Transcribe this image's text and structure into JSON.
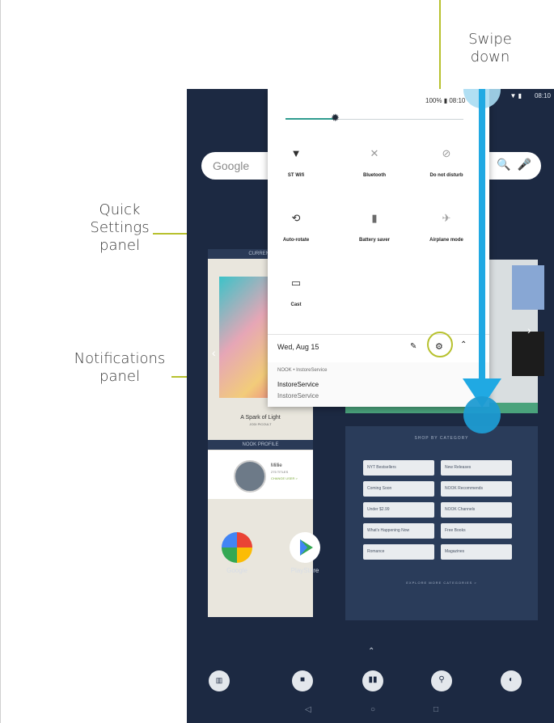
{
  "annotations": {
    "swipe": "Swipe\ndown",
    "quick_settings": "Quick\nSettings\npanel",
    "notifications": "Notifications\npanel"
  },
  "status_bar": {
    "battery": "100%",
    "time": "08:10",
    "right_time": "08:10"
  },
  "quick_settings": {
    "tiles": [
      {
        "icon": "wifi-icon",
        "label": "ST Wifi"
      },
      {
        "icon": "bluetooth-icon",
        "label": "Bluetooth"
      },
      {
        "icon": "do-not-disturb-icon",
        "label": "Do not disturb"
      },
      {
        "icon": "auto-rotate-icon",
        "label": "Auto-rotate"
      },
      {
        "icon": "battery-saver-icon",
        "label": "Battery saver"
      },
      {
        "icon": "airplane-mode-icon",
        "label": "Airplane mode"
      },
      {
        "icon": "cast-icon",
        "label": "Cast"
      }
    ]
  },
  "notifications": {
    "date": "Wed, Aug 15",
    "app_line": "NOOK • InstoreService",
    "title": "InstoreService",
    "text": "InstoreService"
  },
  "home": {
    "search_logo": "Google",
    "current_header": "CURRENT",
    "book_title": "A Spark of Light",
    "book_author": "JODI PICOULT",
    "nook_profile_header": "NOOK PROFILE",
    "profile_name": "Millie",
    "profile_sub": "275 TITLES",
    "profile_link": "CHANGE USER >",
    "shop_title": "SHOP BY CATEGORY",
    "shop_buttons": [
      "NYT Bestsellers",
      "New Releases",
      "Coming Soon",
      "NOOK Recommends",
      "Under $2.99",
      "NOOK Channels",
      "What's Happening Now",
      "Free Books",
      "Romance",
      "Magazines"
    ],
    "shop_explore": "EXPLORE MORE CATEGORIES >",
    "apps": [
      {
        "label": "Google"
      },
      {
        "label": "PlayStore"
      }
    ]
  },
  "colors": {
    "accent_annotation": "#b7c12e",
    "swipe_blue": "#20a9e3",
    "tablet_bg": "#1c2942"
  }
}
